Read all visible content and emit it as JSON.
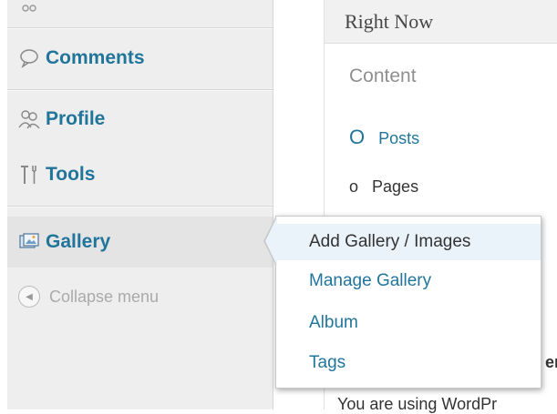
{
  "sidebar": {
    "top_item_label": "",
    "comments_label": "Comments",
    "profile_label": "Profile",
    "tools_label": "Tools",
    "gallery_label": "Gallery",
    "collapse_label": "Collapse menu"
  },
  "main": {
    "right_now_title": "Right Now",
    "content_label": "Content",
    "posts_count": "O",
    "posts_label": "Posts",
    "pages_count": "o",
    "pages_label": "Pages",
    "fragment_er": "er",
    "fragment_bottom": "You are using WordPr"
  },
  "flyout": {
    "items": [
      {
        "label": "Add Gallery / Images"
      },
      {
        "label": "Manage Gallery"
      },
      {
        "label": "Album"
      },
      {
        "label": "Tags"
      }
    ]
  },
  "colors": {
    "link": "#21759b",
    "sidebar_bg": "#eeeeee",
    "highlight": "#eaf2fa"
  },
  "icons": [
    "comment-bubble-icon",
    "users-icon",
    "tools-icon",
    "gallery-image-icon",
    "collapse-arrow-icon"
  ]
}
